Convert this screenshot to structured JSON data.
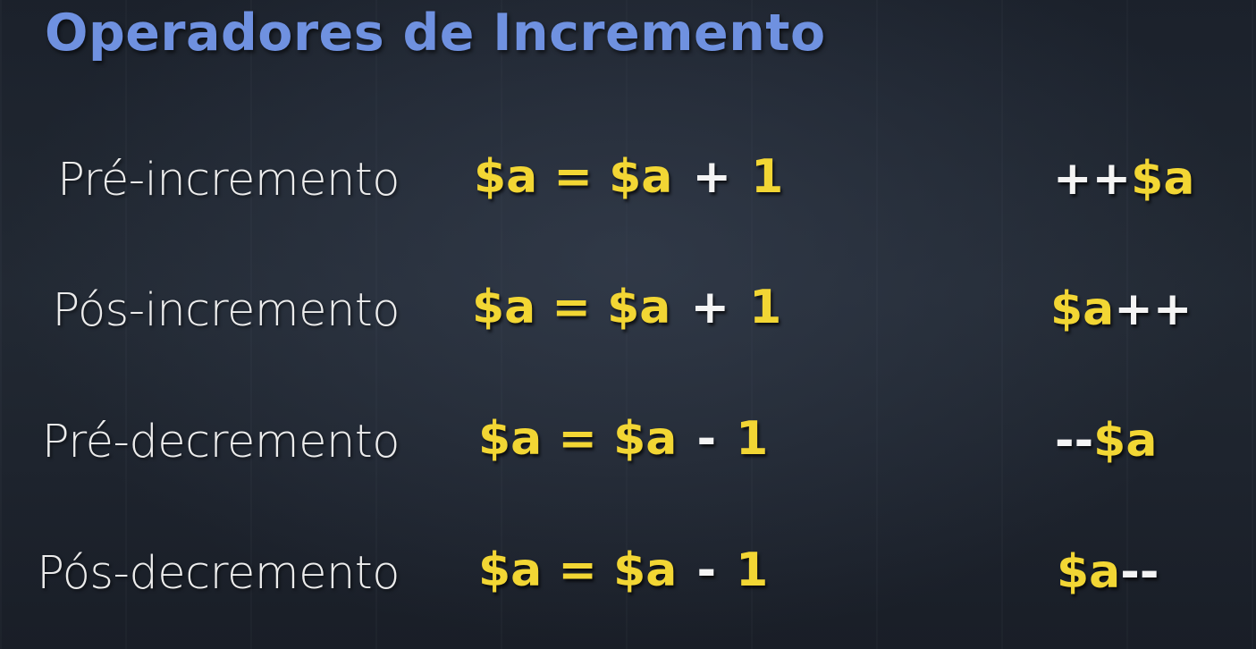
{
  "title": "Operadores de Incremento",
  "colors": {
    "title": "#6f91e0",
    "label": "#ececec",
    "variable": "#f2d634",
    "operator": "#f4f4f4",
    "background": "#1f252f"
  },
  "rows": [
    {
      "label": "Pré-incremento",
      "formula": {
        "lhs": "$a",
        "eq": "=",
        "var": "$a",
        "op": "+",
        "num": "1"
      },
      "notation": {
        "prefix": "++",
        "var": "$a",
        "suffix": ""
      }
    },
    {
      "label": "Pós-incremento",
      "formula": {
        "lhs": "$a",
        "eq": "=",
        "var": "$a",
        "op": "+",
        "num": "1"
      },
      "notation": {
        "prefix": "",
        "var": "$a",
        "suffix": "++"
      }
    },
    {
      "label": "Pré-decremento",
      "formula": {
        "lhs": "$a",
        "eq": "=",
        "var": "$a",
        "op": "-",
        "num": "1"
      },
      "notation": {
        "prefix": "--",
        "var": "$a",
        "suffix": ""
      }
    },
    {
      "label": "Pós-decremento",
      "formula": {
        "lhs": "$a",
        "eq": "=",
        "var": "$a",
        "op": "-",
        "num": "1"
      },
      "notation": {
        "prefix": "",
        "var": "$a",
        "suffix": "--"
      }
    }
  ]
}
